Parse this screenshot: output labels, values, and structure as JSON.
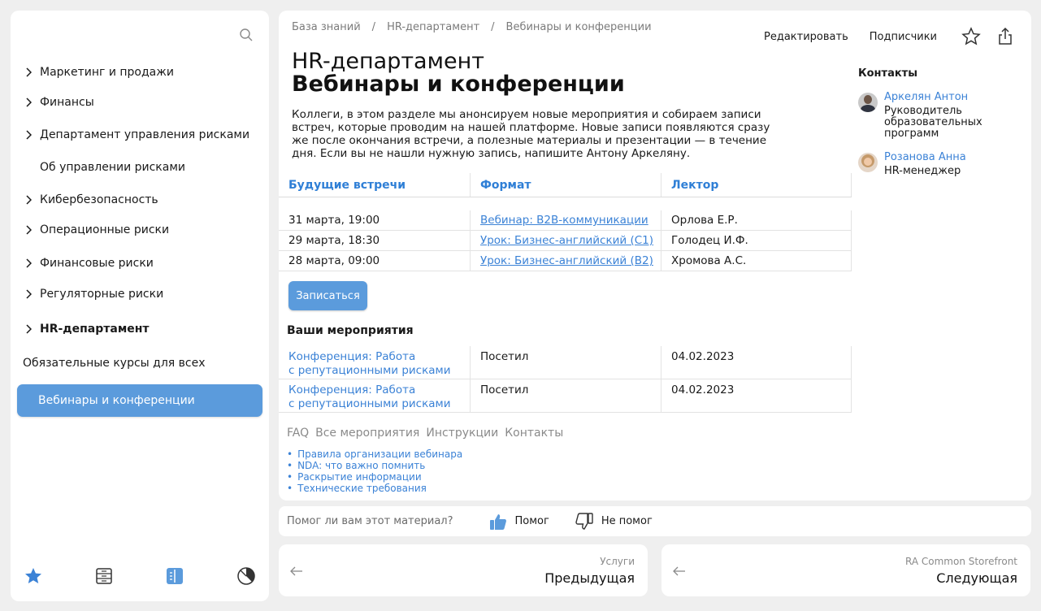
{
  "sidebar": {
    "items": [
      {
        "label": "Маркетинг и продажи"
      },
      {
        "label": "Финансы"
      },
      {
        "label": "Департамент управления рисками"
      },
      {
        "label": "Об управлении рисками"
      },
      {
        "label": "Кибербезопасность"
      },
      {
        "label": "Операционные риски"
      },
      {
        "label": "Финансовые риски"
      },
      {
        "label": "Регуляторные риски"
      },
      {
        "label": "HR-департамент"
      },
      {
        "label": "Обязательные курсы для всех"
      },
      {
        "label": "Вебинары и конференции"
      }
    ],
    "bottom_icons": [
      "star-icon",
      "catalog-icon",
      "book-icon",
      "chart-icon"
    ]
  },
  "breadcrumbs": [
    "База знаний",
    "HR-департамент",
    "Вебинары и конференции"
  ],
  "actions": {
    "edit": "Редактировать",
    "subscribers": "Подписчики"
  },
  "page": {
    "subtitle": "HR-департамент",
    "title": "Вебинары и конференции",
    "intro": "Коллеги, в этом разделе мы анонсируем новые мероприятия и собираем записи встреч, которые проводим на нашей платформе. Новые записи появляются сразу же после окончания встречи, а полезные материалы и презентации — в течение дня. Если вы не нашли нужную запись, напишите Антону Аркеляну."
  },
  "contacts": {
    "title": "Контакты",
    "people": [
      {
        "name": "Аркелян Антон",
        "role": "Руководитель образовательных программ"
      },
      {
        "name": "Розанова Анна",
        "role": "HR-менеджер"
      }
    ]
  },
  "upcoming": {
    "headers": [
      "Будущие встречи",
      "Формат",
      "Лектор"
    ],
    "rows": [
      {
        "date": "31 марта, 19:00",
        "format": "Вебинар: B2B-коммуникации",
        "lecturer": "Орлова Е.Р."
      },
      {
        "date": "29 марта, 18:30",
        "format": "Урок: Бизнес-английский (C1)",
        "lecturer": "Голодец И.Ф."
      },
      {
        "date": "28 марта, 09:00",
        "format": "Урок: Бизнес-английский (B2)",
        "lecturer": "Хромова А.С."
      }
    ],
    "signup_label": "Записаться"
  },
  "my_events": {
    "title": "Ваши мероприятия",
    "rows": [
      {
        "name_line1": "Конференция: Работа",
        "name_line2": "с репутационными рисками",
        "status": "Посетил",
        "date": "04.02.2023"
      },
      {
        "name_line1": "Конференция: Работа",
        "name_line2": "с репутационными рисками",
        "status": "Посетил",
        "date": "04.02.2023"
      }
    ]
  },
  "footer_links": [
    "FAQ",
    "Все мероприятия",
    "Инструкции",
    "Контакты"
  ],
  "resources": [
    "Правила организации вебинара",
    "NDA: что важно помнить",
    "Раскрытие информации",
    "Технические требования"
  ],
  "feedback": {
    "question": "Помог ли вам этот материал?",
    "yes": "Помог",
    "no": "Не помог"
  },
  "pager": {
    "prev": {
      "section": "Услуги",
      "label": "Предыдущая"
    },
    "next": {
      "section": "RA Common Storefront",
      "label": "Следующая"
    }
  },
  "colors": {
    "accent": "#5b9bdc",
    "link": "#3b82d6",
    "background": "#efefef"
  }
}
